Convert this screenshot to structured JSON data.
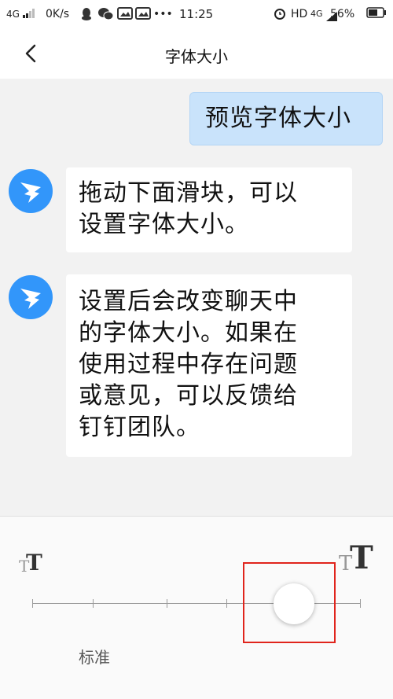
{
  "status_bar": {
    "network_left": "4G",
    "speed": "0K/s",
    "icons_left": [
      "qq-icon",
      "wechat-icon",
      "gallery-icon",
      "gallery-icon"
    ],
    "more": "•••",
    "time": "11:25",
    "hd": "HD",
    "network_right": "4G",
    "battery": "56%"
  },
  "header": {
    "title": "字体大小"
  },
  "messages": [
    {
      "side": "right",
      "text": "预览字体大小"
    },
    {
      "side": "left",
      "lines": [
        "拖动下面滑块，可以",
        "设置字体大小。"
      ]
    },
    {
      "side": "left",
      "lines": [
        "设置后会改变聊天中",
        "的字体大小。如果在",
        "使用过程中存在问题",
        "或意见，可以反馈给",
        "钉钉团队。"
      ]
    }
  ],
  "font_slider": {
    "label": "标准",
    "steps": 6,
    "selected_step": 5,
    "small_icon": "small-t-icon",
    "large_icon": "large-t-icon"
  },
  "colors": {
    "accent": "#3296fa",
    "my_bubble": "#c9e3fb",
    "highlight_box": "#e0241c"
  }
}
